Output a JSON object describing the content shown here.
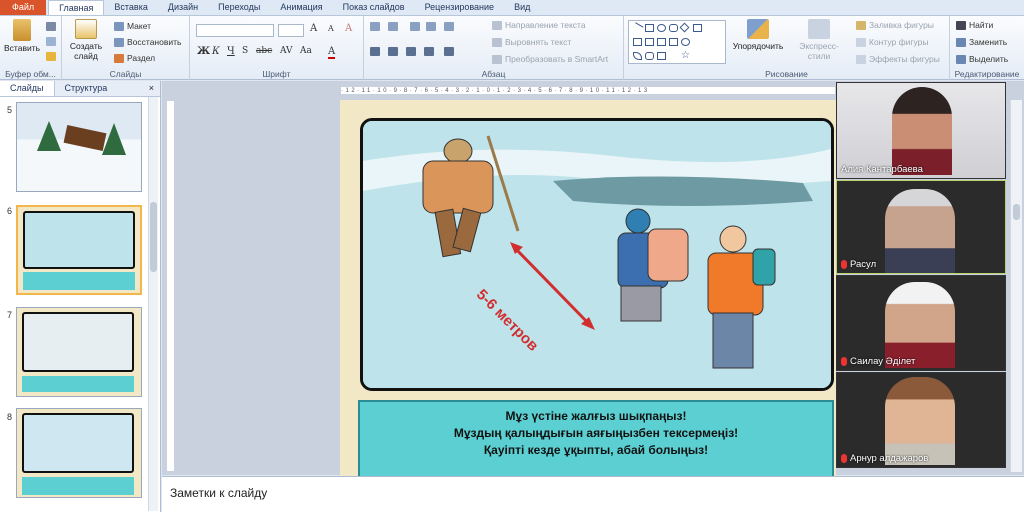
{
  "tabs": [
    "Файл",
    "Главная",
    "Вставка",
    "Дизайн",
    "Переходы",
    "Анимация",
    "Показ слайдов",
    "Рецензирование",
    "Вид"
  ],
  "ribbon": {
    "clipboard": {
      "paste_label": "Вставить",
      "group_label": "Буфер обм..."
    },
    "slides": {
      "new_slide_label": "Создать слайд",
      "layout_label": "Макет",
      "reset_label": "Восстановить",
      "section_label": "Раздел",
      "group_label": "Слайды"
    },
    "font": {
      "group_label": "Шрифт"
    },
    "paragraph": {
      "text_direction": "Направление текста",
      "align_text": "Выровнять текст",
      "smartart": "Преобразовать в SmartArt",
      "group_label": "Абзац"
    },
    "drawing": {
      "arrange": "Упорядочить",
      "quick_styles": "Экспресс-стили",
      "shape_fill": "Заливка фигуры",
      "shape_outline": "Контур фигуры",
      "shape_effects": "Эффекты фигуры",
      "group_label": "Рисование"
    },
    "editing": {
      "find": "Найти",
      "replace": "Заменить",
      "select": "Выделить",
      "group_label": "Редактирование"
    }
  },
  "left_pane": {
    "tab_slides": "Слайды",
    "tab_outline": "Структура",
    "close": "×",
    "slide_numbers": [
      "5",
      "6",
      "7",
      "8"
    ]
  },
  "slide": {
    "distance_label": "5-6 метров",
    "caption_lines": [
      "Мұз үстіне жалғыз шықпаңыз!",
      "Мұздың қалыңдығын аяғыңызбен тексермеңіз!",
      "Қауіпті кезде ұқыпты, абай болыңыз!"
    ]
  },
  "notes_placeholder": "Заметки к слайду",
  "participants": [
    "Алия Кантарбаева",
    "Расул",
    "Саилау Әділет",
    "Арнур алдажаров"
  ],
  "colors": {
    "file_tab": "#d9542b",
    "slide_bg": "#f3e8c6",
    "caption_bg": "#5ccfd2",
    "ice": "#bfe3ea",
    "selection": "#f3b64b"
  }
}
